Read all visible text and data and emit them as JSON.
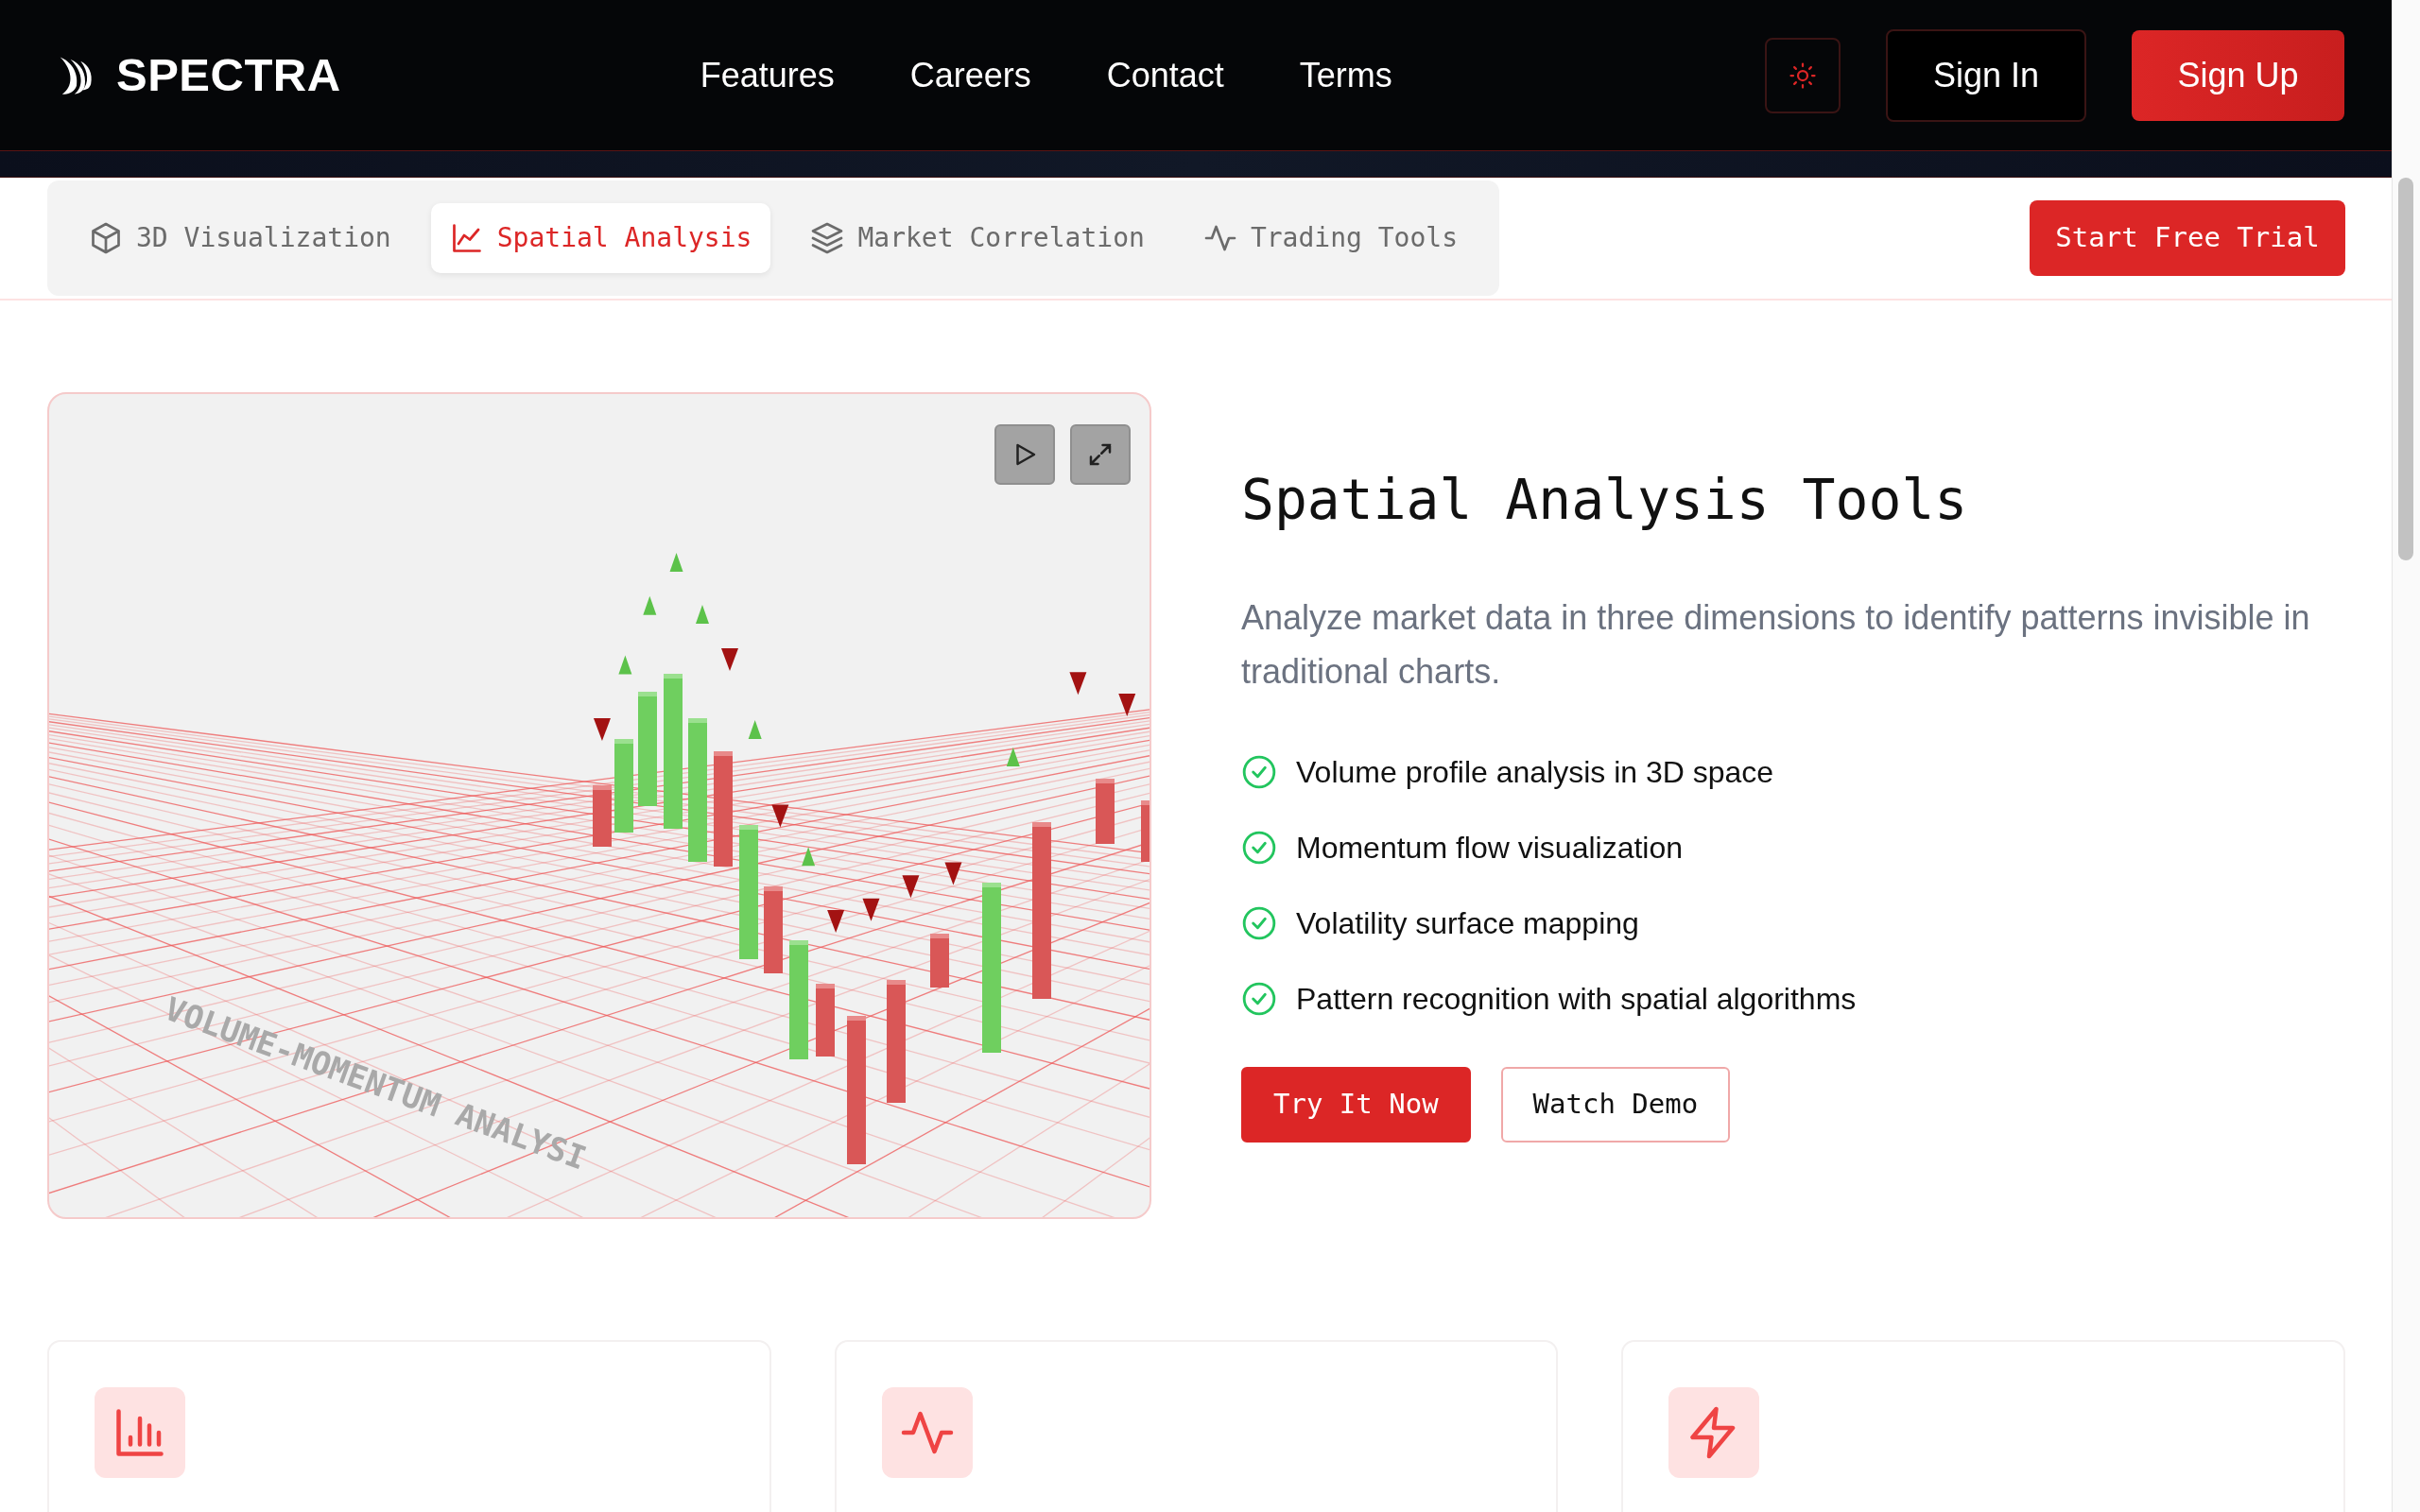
{
  "brand": {
    "name": "SPECTRA"
  },
  "nav_links": [
    "Features",
    "Careers",
    "Contact",
    "Terms"
  ],
  "header_buttons": [
    {
      "label": "Sign In",
      "kind": "outline"
    },
    {
      "label": "Sign Up",
      "kind": "primary"
    }
  ],
  "tabs": [
    {
      "label": "3D Visualization",
      "kind": "cube",
      "selected": false
    },
    {
      "label": "Spatial Analysis",
      "kind": "chart",
      "selected": true
    },
    {
      "label": "Market Correlation",
      "kind": "layers",
      "selected": false
    },
    {
      "label": "Trading Tools",
      "kind": "pulse",
      "selected": false
    }
  ],
  "cta": "Start Free Trial",
  "visual": {
    "caption": "VOLUME-MOMENTUM ANALYSI"
  },
  "hero": {
    "title": "Spatial Analysis Tools",
    "description": "Analyze market data in three dimensions to identify patterns invisible in traditional charts.",
    "features": [
      "Volume profile analysis in 3D space",
      "Momentum flow visualization",
      "Volatility surface mapping",
      "Pattern recognition with spatial algorithms"
    ],
    "buttons": [
      {
        "label": "Try It Now",
        "kind": "primary"
      },
      {
        "label": "Watch Demo",
        "kind": "outline"
      }
    ]
  },
  "feature_cards": [
    {
      "kind": "bars"
    },
    {
      "kind": "pulse"
    },
    {
      "kind": "bolt"
    }
  ]
}
